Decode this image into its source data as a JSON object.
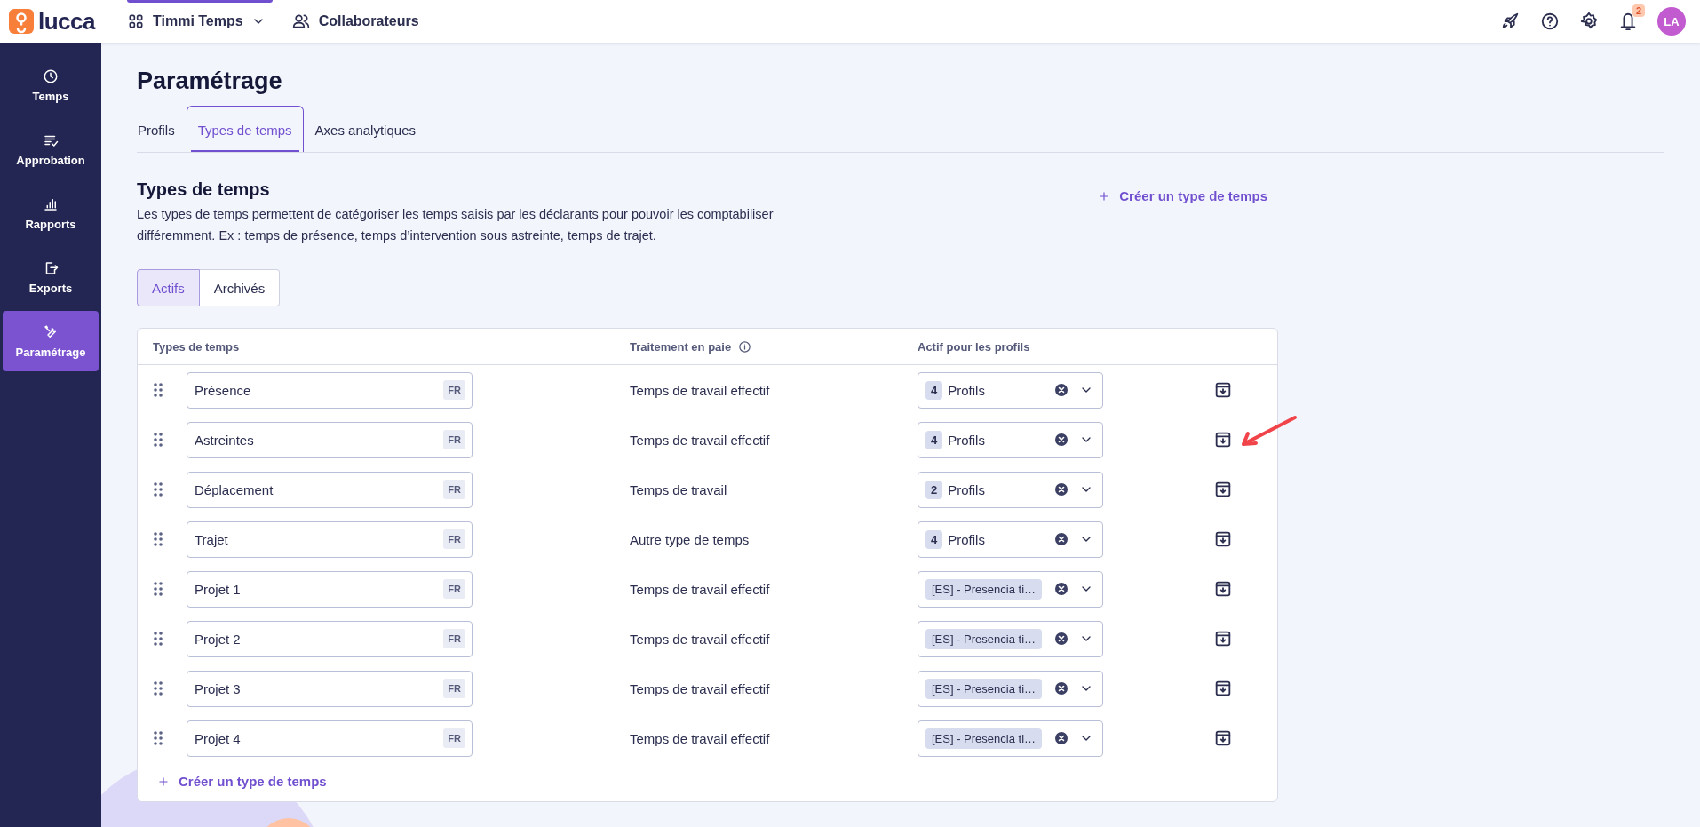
{
  "topbar": {
    "logo_text": "lucca",
    "app_switcher": "Timmi Temps",
    "nav_link": "Collaborateurs",
    "notification_count": "2",
    "avatar_initials": "LA"
  },
  "sidebar": {
    "items": [
      {
        "label": "Temps",
        "selected": false
      },
      {
        "label": "Approbation",
        "selected": false
      },
      {
        "label": "Rapports",
        "selected": false
      },
      {
        "label": "Exports",
        "selected": false
      },
      {
        "label": "Paramétrage",
        "selected": true
      }
    ]
  },
  "page": {
    "title": "Paramétrage",
    "tabs": [
      {
        "label": "Profils",
        "selected": false
      },
      {
        "label": "Types de temps",
        "selected": true
      },
      {
        "label": "Axes analytiques",
        "selected": false
      }
    ]
  },
  "section": {
    "title": "Types de temps",
    "description": "Les types de temps permettent de catégoriser les temps saisis par les déclarants pour pouvoir les comptabiliser différemment. Ex : temps de présence, temps d’intervention sous astreinte, temps de trajet.",
    "create_action": "Créer un type de temps"
  },
  "filter_tabs": [
    {
      "label": "Actifs",
      "selected": true
    },
    {
      "label": "Archivés",
      "selected": false
    }
  ],
  "table": {
    "columns": [
      {
        "label": "Types de temps",
        "info": false
      },
      {
        "label": "Traitement en paie",
        "info": true
      },
      {
        "label": "Actif pour les profils",
        "info": false
      }
    ],
    "rows": [
      {
        "name": "Présence",
        "language": "FR",
        "payroll": "Temps de travail effectif",
        "profiles": {
          "kind": "count",
          "count": "4",
          "label": "Profils"
        },
        "annotated": false
      },
      {
        "name": "Astreintes",
        "language": "FR",
        "payroll": "Temps de travail effectif",
        "profiles": {
          "kind": "count",
          "count": "4",
          "label": "Profils"
        },
        "annotated": true
      },
      {
        "name": "Déplacement",
        "language": "FR",
        "payroll": "Temps de travail",
        "profiles": {
          "kind": "count",
          "count": "2",
          "label": "Profils"
        },
        "annotated": false
      },
      {
        "name": "Trajet",
        "language": "FR",
        "payroll": "Autre type de temps",
        "profiles": {
          "kind": "count",
          "count": "4",
          "label": "Profils"
        },
        "annotated": false
      },
      {
        "name": "Projet 1",
        "language": "FR",
        "payroll": "Temps de travail effectif",
        "profiles": {
          "kind": "tag",
          "label": "[ES] - Presencia ti…"
        },
        "annotated": false
      },
      {
        "name": "Projet 2",
        "language": "FR",
        "payroll": "Temps de travail effectif",
        "profiles": {
          "kind": "tag",
          "label": "[ES] - Presencia ti…"
        },
        "annotated": false
      },
      {
        "name": "Projet 3",
        "language": "FR",
        "payroll": "Temps de travail effectif",
        "profiles": {
          "kind": "tag",
          "label": "[ES] - Presencia ti…"
        },
        "annotated": false
      },
      {
        "name": "Projet 4",
        "language": "FR",
        "payroll": "Temps de travail effectif",
        "profiles": {
          "kind": "tag",
          "label": "[ES] - Presencia ti…"
        },
        "annotated": false
      }
    ],
    "add_action": "Créer un type de temps"
  }
}
